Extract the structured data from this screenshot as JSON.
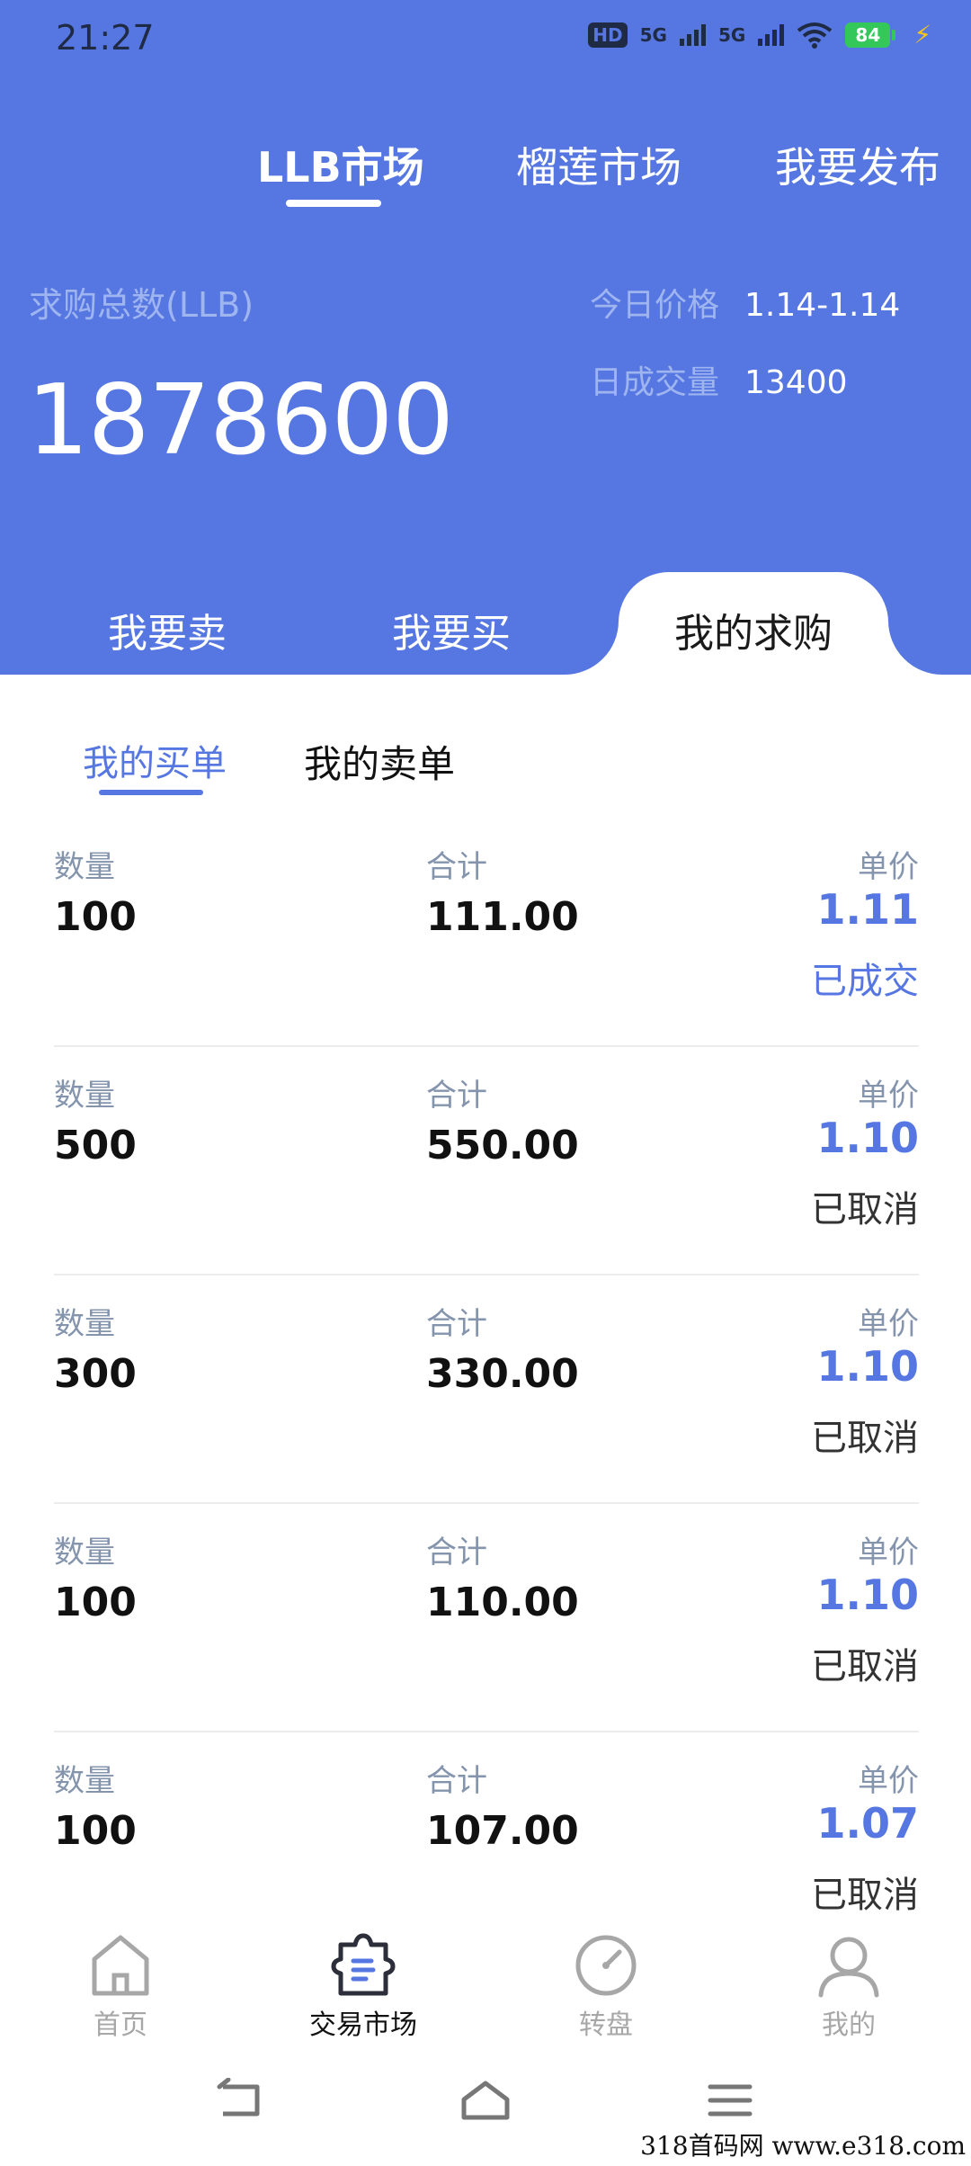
{
  "status_bar": {
    "time": "21:27",
    "hd": "HD",
    "signal1": "5G",
    "signal2": "5G",
    "battery": "84"
  },
  "top_tabs": [
    {
      "label": "LLB市场",
      "active": true
    },
    {
      "label": "榴莲市场",
      "active": false
    },
    {
      "label": "我要发布",
      "active": false
    }
  ],
  "stats": {
    "total_label": "求购总数(LLB)",
    "total_value": "1878600",
    "price_label": "今日价格",
    "price_value": "1.14-1.14",
    "volume_label": "日成交量",
    "volume_value": "13400"
  },
  "trade_tabs": [
    {
      "label": "我要卖",
      "active": false
    },
    {
      "label": "我要买",
      "active": false
    },
    {
      "label": "我的求购",
      "active": true
    }
  ],
  "sub_tabs": [
    {
      "label": "我的买单",
      "active": true
    },
    {
      "label": "我的卖单",
      "active": false
    }
  ],
  "column_labels": {
    "quantity": "数量",
    "total": "合计",
    "unit_price": "单价"
  },
  "orders": [
    {
      "quantity": "100",
      "total": "111.00",
      "unit_price": "1.11",
      "status": "已成交"
    },
    {
      "quantity": "500",
      "total": "550.00",
      "unit_price": "1.10",
      "status": "已取消"
    },
    {
      "quantity": "300",
      "total": "330.00",
      "unit_price": "1.10",
      "status": "已取消"
    },
    {
      "quantity": "100",
      "total": "110.00",
      "unit_price": "1.10",
      "status": "已取消"
    },
    {
      "quantity": "100",
      "total": "107.00",
      "unit_price": "1.07",
      "status": "已取消"
    }
  ],
  "bottom_nav": [
    {
      "label": "首页",
      "icon": "home-icon",
      "active": false
    },
    {
      "label": "交易市场",
      "icon": "market-icon",
      "active": true
    },
    {
      "label": "转盘",
      "icon": "wheel-icon",
      "active": false
    },
    {
      "label": "我的",
      "icon": "profile-icon",
      "active": false
    }
  ],
  "watermark": "318首码网  www.e318.com",
  "colors": {
    "brand": "#5677e2",
    "label_muted": "#9fb5f0",
    "text_grey": "#8494ad"
  }
}
